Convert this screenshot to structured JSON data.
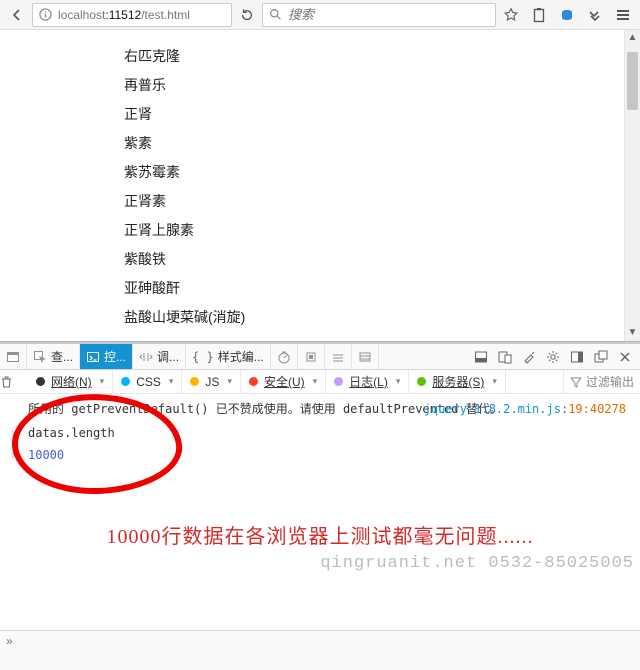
{
  "browser": {
    "url_display": "localhost:11512/test.html",
    "url_host": "localhost",
    "url_port": ":11512",
    "url_path": "/test.html",
    "search_placeholder": "搜索"
  },
  "page_list_items": [
    "右匹克隆",
    "再普乐",
    "正肾",
    "紫素",
    "紫苏霉素",
    "正肾素",
    "正肾上腺素",
    "紫酸铁",
    "亚砷酸酐",
    "盐酸山埂菜碱(消旋)"
  ],
  "devtools": {
    "tabs": {
      "inspector": "查...",
      "console": "控...",
      "debugger": "调...",
      "style": "样式编..."
    },
    "filters": {
      "network": "网络(N)",
      "css": "CSS",
      "js": "JS",
      "security": "安全(U)",
      "log": "日志(L)",
      "server": "服务器(S)",
      "filter_label": "过滤输出"
    },
    "colors": {
      "network": "#333333",
      "css": "#00b2ff",
      "js": "#ffb300",
      "security": "#ff3b30",
      "log": "#c799ff",
      "server": "#5cc100"
    },
    "console_lines": {
      "warn_text": "所用的 getPreventDefault() 已不赞成使用。请使用 defaultPrevented 替代。",
      "source_file": "jquery-1.8.2.min.js",
      "source_loc": "19:40278",
      "input_text": "datas.length",
      "output_text": "10000"
    },
    "annotation": "10000行数据在各浏览器上测试都毫无问题......",
    "watermark": "qingruanit.net 0532-85025005"
  }
}
